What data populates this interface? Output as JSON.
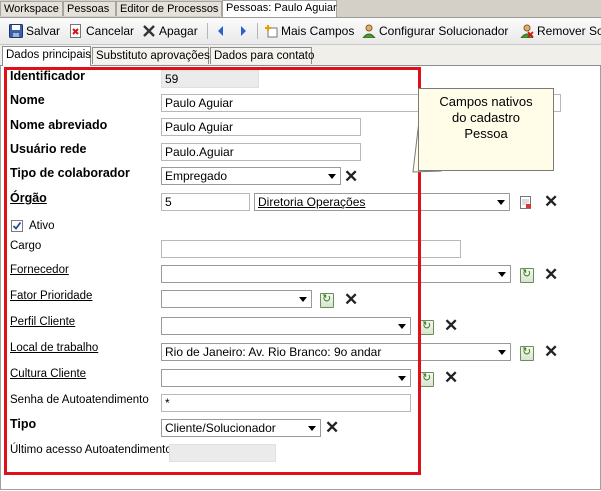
{
  "top_tabs": [
    "Workspace",
    "Pessoas",
    "Editor de Processos",
    "Pessoas: Paulo Aguiar"
  ],
  "toolbar": {
    "save": "Salvar",
    "cancel": "Cancelar",
    "delete": "Apagar",
    "more_fields": "Mais Campos",
    "configure": "Configurar Solucionador",
    "remove": "Remover So"
  },
  "sub_tabs": [
    "Dados principais",
    "Substituto aprovações",
    "Dados para contato"
  ],
  "form": {
    "identificador": {
      "label": "Identificador",
      "value": "59"
    },
    "nome": {
      "label": "Nome",
      "value": "Paulo Aguiar"
    },
    "nome_abreviado": {
      "label": "Nome abreviado",
      "value": "Paulo Aguiar"
    },
    "usuario_rede": {
      "label": "Usuário rede",
      "value": "Paulo.Aguiar"
    },
    "tipo_colaborador": {
      "label": "Tipo de colaborador",
      "value": "Empregado"
    },
    "orgao": {
      "label": "Órgão",
      "code": "5",
      "value": "Diretoria Operações"
    },
    "ativo": {
      "label": "Ativo",
      "checked": true
    },
    "cargo": {
      "label": "Cargo",
      "value": ""
    },
    "fornecedor": {
      "label": "Fornecedor",
      "value": ""
    },
    "fator_prioridade": {
      "label": "Fator Prioridade",
      "value": ""
    },
    "perfil_cliente": {
      "label": "Perfil Cliente",
      "value": ""
    },
    "local_trabalho": {
      "label": "Local de trabalho",
      "value": "Rio de Janeiro: Av. Rio Branco: 9o andar"
    },
    "cultura_cliente": {
      "label": "Cultura Cliente",
      "value": ""
    },
    "senha": {
      "label": "Senha de Autoatendimento",
      "value": "*"
    },
    "tipo": {
      "label": "Tipo",
      "value": "Cliente/Solucionador"
    },
    "ultimo_acesso": {
      "label": "Último acesso Autoatendimento",
      "value": ""
    }
  },
  "callout": {
    "lines": [
      "Campos nativos",
      "do cadastro",
      "Pessoa"
    ]
  },
  "colors": {
    "highlight": "#e0101a",
    "callout_bg": "#fffde8"
  }
}
